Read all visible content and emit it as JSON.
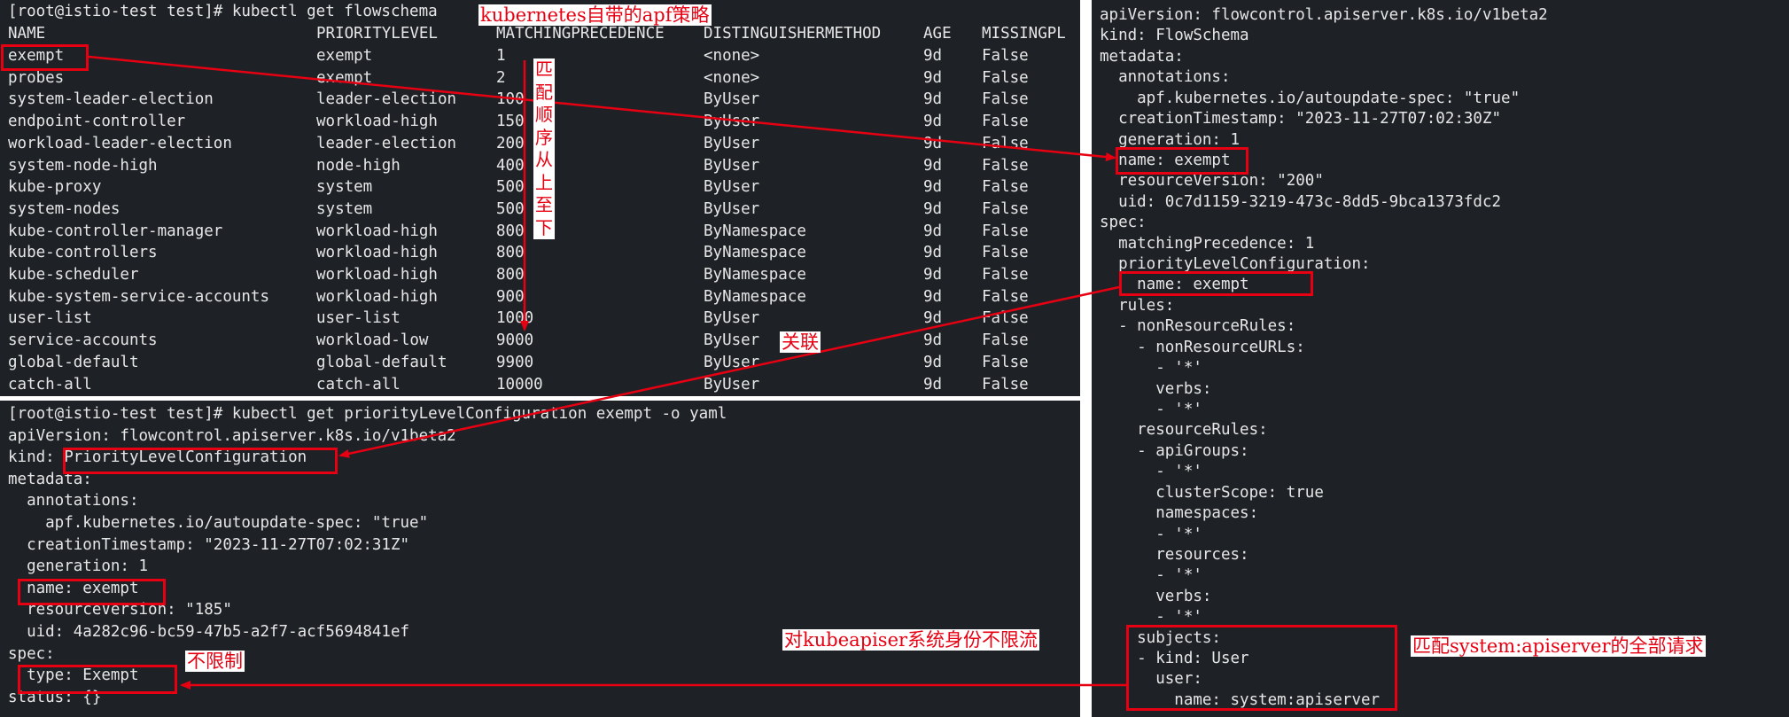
{
  "flowschema_terminal": {
    "prompt": "[root@istio-test test]# kubectl get flowschema",
    "columns": [
      "NAME",
      "PRIORITYLEVEL",
      "MATCHINGPRECEDENCE",
      "DISTINGUISHERMETHOD",
      "AGE",
      "MISSINGPL"
    ],
    "rows": [
      [
        "exempt",
        "exempt",
        "1",
        "<none>",
        "9d",
        "False"
      ],
      [
        "probes",
        "exempt",
        "2",
        "<none>",
        "9d",
        "False"
      ],
      [
        "system-leader-election",
        "leader-election",
        "100",
        "ByUser",
        "9d",
        "False"
      ],
      [
        "endpoint-controller",
        "workload-high",
        "150",
        "ByUser",
        "9d",
        "False"
      ],
      [
        "workload-leader-election",
        "leader-election",
        "200",
        "ByUser",
        "9d",
        "False"
      ],
      [
        "system-node-high",
        "node-high",
        "400",
        "ByUser",
        "9d",
        "False"
      ],
      [
        "kube-proxy",
        "system",
        "500",
        "ByUser",
        "9d",
        "False"
      ],
      [
        "system-nodes",
        "system",
        "500",
        "ByUser",
        "9d",
        "False"
      ],
      [
        "kube-controller-manager",
        "workload-high",
        "800",
        "ByNamespace",
        "9d",
        "False"
      ],
      [
        "kube-controllers",
        "workload-high",
        "800",
        "ByNamespace",
        "9d",
        "False"
      ],
      [
        "kube-scheduler",
        "workload-high",
        "800",
        "ByNamespace",
        "9d",
        "False"
      ],
      [
        "kube-system-service-accounts",
        "workload-high",
        "900",
        "ByNamespace",
        "9d",
        "False"
      ],
      [
        "user-list",
        "user-list",
        "1000",
        "ByUser",
        "9d",
        "False"
      ],
      [
        "service-accounts",
        "workload-low",
        "9000",
        "ByUser",
        "9d",
        "False"
      ],
      [
        "global-default",
        "global-default",
        "9900",
        "ByUser",
        "9d",
        "False"
      ],
      [
        "catch-all",
        "catch-all",
        "10000",
        "ByUser",
        "9d",
        "False"
      ]
    ]
  },
  "plc_terminal": {
    "lines": [
      "[root@istio-test test]# kubectl get priorityLevelConfiguration exempt -o yaml",
      "apiVersion: flowcontrol.apiserver.k8s.io/v1beta2",
      "kind: PriorityLevelConfiguration",
      "metadata:",
      "  annotations:",
      "    apf.kubernetes.io/autoupdate-spec: \"true\"",
      "  creationTimestamp: \"2023-11-27T07:02:31Z\"",
      "  generation: 1",
      "  name: exempt",
      "  resourceVersion: \"185\"",
      "  uid: 4a282c96-bc59-47b5-a2f7-acf5694841ef",
      "spec:",
      "  type: Exempt",
      "status: {}"
    ]
  },
  "flowschema_yaml_terminal": {
    "lines": [
      "apiVersion: flowcontrol.apiserver.k8s.io/v1beta2",
      "kind: FlowSchema",
      "metadata:",
      "  annotations:",
      "    apf.kubernetes.io/autoupdate-spec: \"true\"",
      "  creationTimestamp: \"2023-11-27T07:02:30Z\"",
      "  generation: 1",
      "  name: exempt",
      "  resourceVersion: \"200\"",
      "  uid: 0c7d1159-3219-473c-8dd5-9bca1373fdc2",
      "spec:",
      "  matchingPrecedence: 1",
      "  priorityLevelConfiguration:",
      "    name: exempt",
      "  rules:",
      "  - nonResourceRules:",
      "    - nonResourceURLs:",
      "      - '*'",
      "      verbs:",
      "      - '*'",
      "    resourceRules:",
      "    - apiGroups:",
      "      - '*'",
      "      clusterScope: true",
      "      namespaces:",
      "      - '*'",
      "      resources:",
      "      - '*'",
      "      verbs:",
      "      - '*'",
      "    subjects:",
      "    - kind: User",
      "      user:",
      "        name: system:apiserver"
    ]
  },
  "annotations": {
    "builtin_apf": "kubernetes自带的apf策略",
    "match_order": "匹配顺序从上至下",
    "association": "关联",
    "no_limit_for_kubeapiserver": "对kubeapiser系统身份不限流",
    "no_limit": "不限制",
    "match_apiserver_requests": "匹配system:apiserver的全部请求"
  },
  "colors": {
    "terminal_bg": "#1e2227",
    "terminal_text": "#e6e6e6",
    "annotation_red": "#e60012"
  }
}
